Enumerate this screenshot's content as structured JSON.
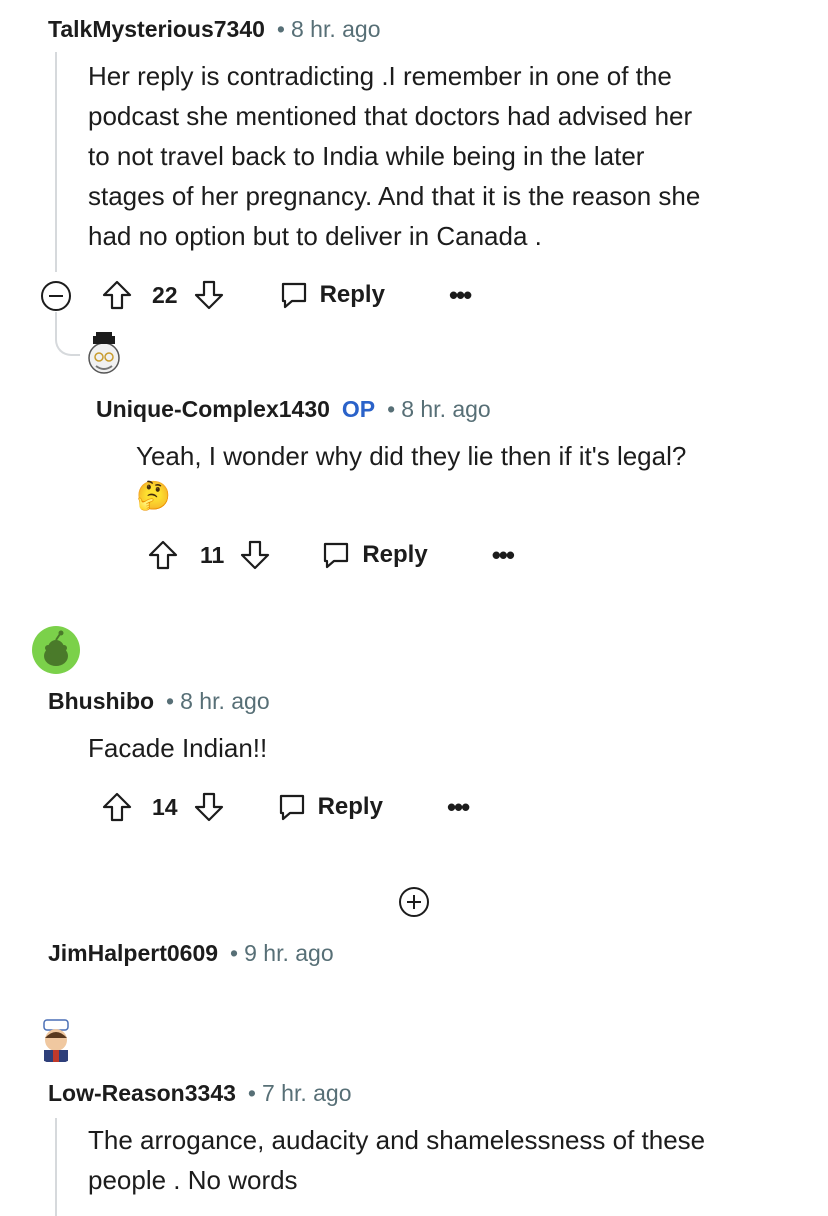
{
  "comments": [
    {
      "author": "TalkMysterious7340",
      "time": "8 hr. ago",
      "lines": [
        "Her reply is contradicting .I remember in one of the",
        "podcast she mentioned that doctors had advised her",
        "to not travel back to India while being in the later",
        "stages of her pregnancy. And that it is the reason she",
        "had no option but to deliver in Canada ."
      ],
      "votes": "22",
      "reply_label": "Reply",
      "more": "•••"
    },
    {
      "author": "Unique-Complex1430",
      "badge": "OP",
      "time": "8 hr. ago",
      "text": "Yeah, I wonder why did they lie then if it's legal?",
      "emoji": "🤔",
      "votes": "11",
      "reply_label": "Reply",
      "more": "•••"
    },
    {
      "author": "Bhushibo",
      "time": "8 hr. ago",
      "text": "Facade Indian!!",
      "votes": "14",
      "reply_label": "Reply",
      "more": "•••"
    },
    {
      "author": "JimHalpert0609",
      "time": "9 hr. ago"
    },
    {
      "author": "Low-Reason3343",
      "time": "7 hr. ago",
      "lines": [
        "The arrogance, audacity and shamelessness of these",
        "people . No words"
      ]
    }
  ],
  "separator": "•",
  "colors": {
    "text": "#1c1c1c",
    "meta": "#576f76",
    "op": "#2a62c9",
    "thread_line": "#d6d9dc",
    "avatar_green": "#7bd14a"
  }
}
